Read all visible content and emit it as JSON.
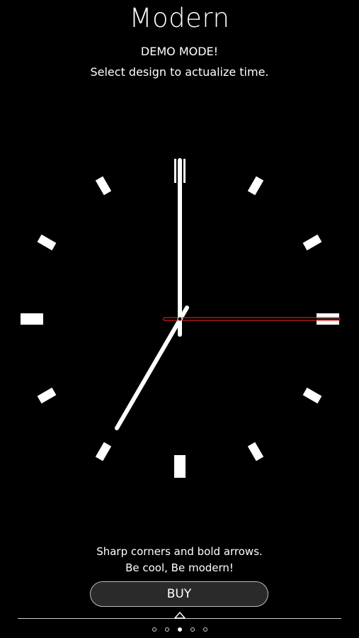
{
  "header": {
    "title": "Modern",
    "demo_label": "DEMO MODE!",
    "instruction": "Select design to actualize time."
  },
  "clock": {
    "design_name": "Modern",
    "time_shown": {
      "hour": 7,
      "minute": 0,
      "second": 15
    },
    "hand_color": "#ffffff",
    "second_hand_color": "#cc1e1e",
    "face_color": "#000000"
  },
  "description": {
    "line1": "Sharp corners and bold arrows.",
    "line2": "Be cool, Be modern!"
  },
  "buy_button": {
    "label": "BUY"
  },
  "pager": {
    "page_count": 5,
    "active_index": 2
  }
}
